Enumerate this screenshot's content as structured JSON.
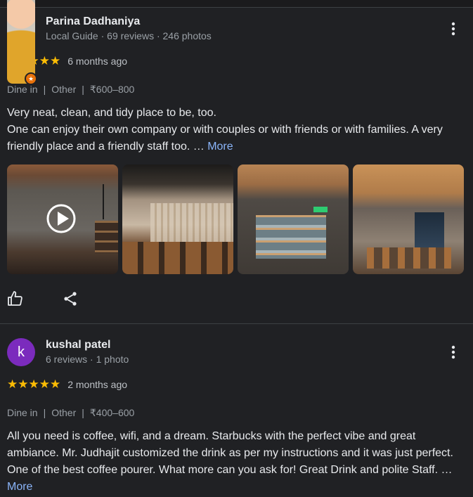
{
  "reviews": [
    {
      "author_name": "Parina Dadhaniya",
      "author_meta": "Local Guide · 69 reviews · 246 photos",
      "avatar_icon": "user-photo",
      "badge_icon": "local-guide-star-icon",
      "stars": "★★★★★",
      "rating": 5,
      "time": "6 months ago",
      "meta": [
        "Dine in",
        "Other",
        "₹600–800"
      ],
      "meta_separator": "|",
      "text": "Very neat, clean, and tidy place to be, too.\nOne can enjoy their own company or with couples or with friends or with families. A very friendly place and a friendly staff too.",
      "ellipsis": " … ",
      "more_label": "More",
      "photos": [
        "video",
        "photo",
        "photo",
        "photo"
      ]
    },
    {
      "author_name": "kushal patel",
      "author_meta": "6 reviews · 1 photo",
      "avatar_letter": "k",
      "stars": "★★★★★",
      "rating": 5,
      "time": "2 months ago",
      "meta": [
        "Dine in",
        "Other",
        "₹400–600"
      ],
      "meta_separator": "|",
      "text": "All you need is coffee, wifi, and a dream. Starbucks with the perfect vibe and great ambiance. Mr. Judhajit customized the drink as per my instructions and it was just perfect. One of the best coffee pourer. What more can you ask for! Great Drink and polite Staff.",
      "ellipsis": " … ",
      "more_label": "More"
    }
  ],
  "colors": {
    "background": "#202124",
    "star": "#fbbc04",
    "link": "#8ab4f8",
    "avatar_k": "#7b2bbd",
    "guide_badge": "#e8710a"
  }
}
